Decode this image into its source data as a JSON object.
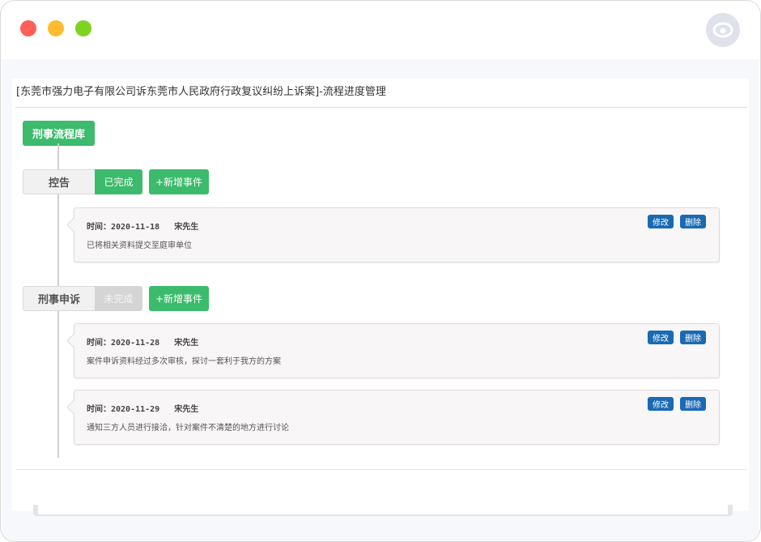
{
  "window": {
    "controls": [
      "close",
      "minimize",
      "maximize"
    ],
    "colors": {
      "close": "#fe5f57",
      "minimize": "#febc2e",
      "maximize": "#7ed321"
    },
    "avatar_icon": "user-avatar-icon"
  },
  "page": {
    "title": "[东莞市强力电子有限公司诉东莞市人民政府行政复议纠纷上诉案]-流程进度管理",
    "library_button": "刑事流程库"
  },
  "stages": [
    {
      "name": "控告",
      "status": "已完成",
      "add_label": "+新增事件",
      "events": [
        {
          "time": "时间：2020-11-18",
          "person": "宋先生",
          "desc": "已将相关资料提交至庭审单位",
          "edit": "修改",
          "delete": "删除"
        }
      ]
    },
    {
      "name": "刑事申诉",
      "status": "未完成",
      "add_label": "+新增事件",
      "events": [
        {
          "time": "时间：2020-11-28",
          "person": "宋先生",
          "desc": "案件申诉资料经过多次审核，探讨一套利于我方的方案",
          "edit": "修改",
          "delete": "删除"
        },
        {
          "time": "时间：2020-11-29",
          "person": "宋先生",
          "desc": "通知三方人员进行接洽，针对案件不清楚的地方进行讨论",
          "edit": "修改",
          "delete": "删除"
        }
      ]
    }
  ],
  "colors": {
    "accent_green": "#3bbb6b",
    "action_blue": "#1a6ab3",
    "pending_gray": "#d5d5d5"
  }
}
